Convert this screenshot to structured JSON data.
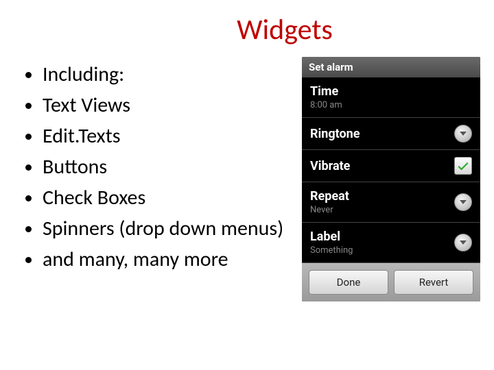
{
  "slide": {
    "title": "Widgets",
    "bullets": [
      "Including:",
      "Text Views",
      "Edit.Texts",
      "Buttons",
      "Check Boxes",
      "Spinners (drop down menus)",
      "and many, many more"
    ]
  },
  "phone": {
    "header": "Set alarm",
    "rows": {
      "time": {
        "title": "Time",
        "sub": "8:00 am"
      },
      "ring": {
        "title": "Ringtone"
      },
      "vibrate": {
        "title": "Vibrate",
        "checked": true
      },
      "repeat": {
        "title": "Repeat",
        "sub": "Never"
      },
      "label": {
        "title": "Label",
        "sub": "Something"
      }
    },
    "buttons": {
      "done": "Done",
      "revert": "Revert"
    }
  }
}
